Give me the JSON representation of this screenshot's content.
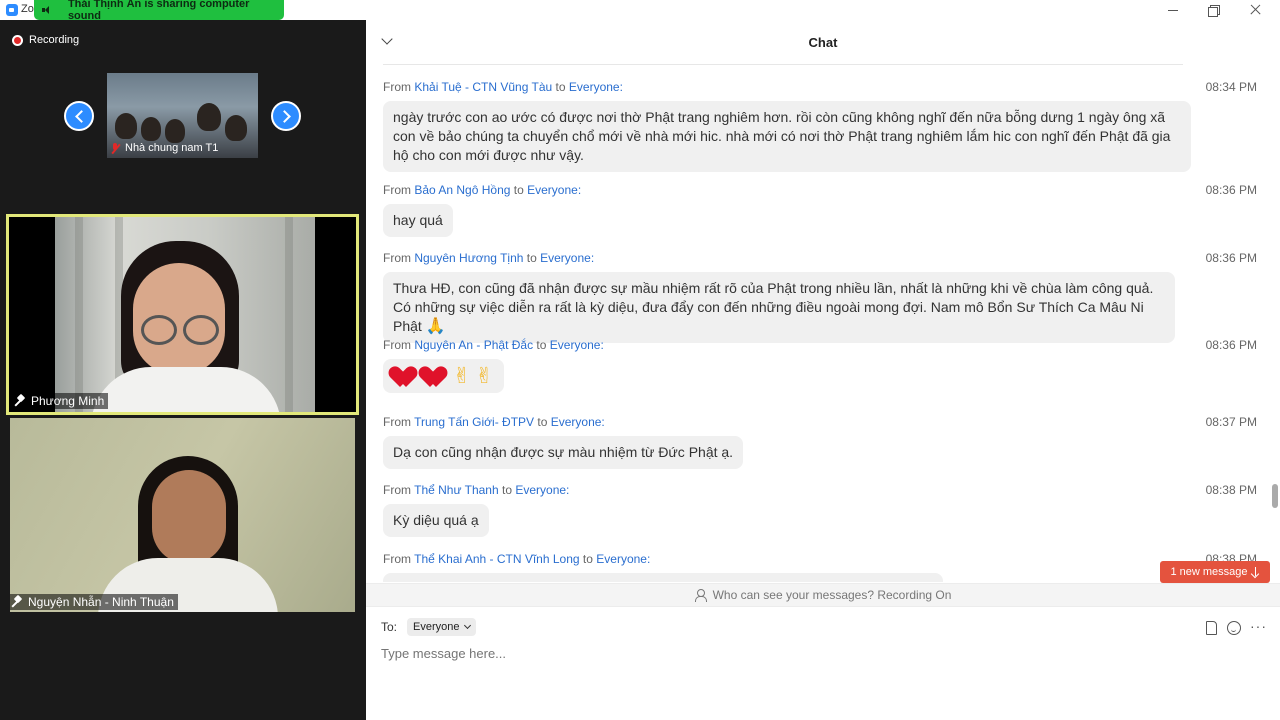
{
  "app": {
    "name_partial": "Zo"
  },
  "share_banner": {
    "text": "Thái Thịnh Ân is sharing computer sound"
  },
  "recording": {
    "label": "Recording"
  },
  "thumbnail": {
    "name": "Nhà chung nam T1"
  },
  "videos": [
    {
      "name": "Phương Minh",
      "active_speaker": true
    },
    {
      "name": "Nguyện Nhẫn - Ninh Thuận"
    }
  ],
  "chat": {
    "title": "Chat",
    "messages": [
      {
        "prefix": "From",
        "sender": "Khải Tuệ - CTN Vũng Tàu",
        "to_word": "to",
        "recipient": "Everyone:",
        "time": "08:34 PM",
        "text": "ngày trước con ao ước có được nơi thờ Phật trang nghiêm hơn. rồi còn cũng không nghĩ đến nữa bỗng dưng 1 ngày ông xã con về bảo chúng ta chuyển chổ mới về nhà mới hic. nhà mới có nơi thờ Phật trang nghiêm lắm hic con nghĩ đến Phật đã gia hộ cho con mới được như vậy."
      },
      {
        "prefix": "From",
        "sender": "Bảo An Ngô Hồng",
        "to_word": "to",
        "recipient": "Everyone:",
        "time": "08:36 PM",
        "text": "hay quá"
      },
      {
        "prefix": "From",
        "sender": "Nguyên Hương Tịnh",
        "to_word": "to",
        "recipient": "Everyone:",
        "time": "08:36 PM",
        "text": "Thưa HĐ, con cũng đã nhận được sự mầu nhiệm rất rõ của Phật trong nhiều lần, nhất là những khi về chùa làm  công quả. Có những sự việc diễn ra rất là kỳ diệu, đưa đẩy con đến những điều ngoài mong đợi. Nam mô Bổn Sư Thích Ca Mâu Ni Phật",
        "emoji": "🙏"
      },
      {
        "prefix": "From",
        "sender": "Nguyên An - Phật Đắc",
        "to_word": "to",
        "recipient": "Everyone:",
        "time": "08:36 PM",
        "emojis": [
          "heart",
          "heart",
          "✌",
          "✌"
        ]
      },
      {
        "prefix": "From",
        "sender": "Trung Tấn Giới- ĐTPV",
        "to_word": "to",
        "recipient": "Everyone:",
        "time": "08:37 PM",
        "text": "Dạ con cũng nhận được sự màu nhiệm từ Đức Phật ạ."
      },
      {
        "prefix": "From",
        "sender": "Thể Như Thanh",
        "to_word": "to",
        "recipient": "Everyone:",
        "time": "08:38 PM",
        "text": "Kỳ diệu quá ạ"
      },
      {
        "prefix": "From",
        "sender": "Thể Khai Anh - CTN Vĩnh Long",
        "to_word": "to",
        "recipient": "Everyone:",
        "time": "08:38 PM"
      }
    ],
    "new_message_label": "1 new message",
    "privacy_text": "Who can see your messages? Recording On",
    "to_label": "To:",
    "to_value": "Everyone",
    "compose_placeholder": "Type message here...",
    "more_label": "···"
  },
  "colors": {
    "accent": "#2d8cff",
    "sender_link": "#2a6ecf",
    "banner_green": "#1fbf3f",
    "speaker_border": "#e2e87a",
    "new_message_red": "#e4533e"
  }
}
